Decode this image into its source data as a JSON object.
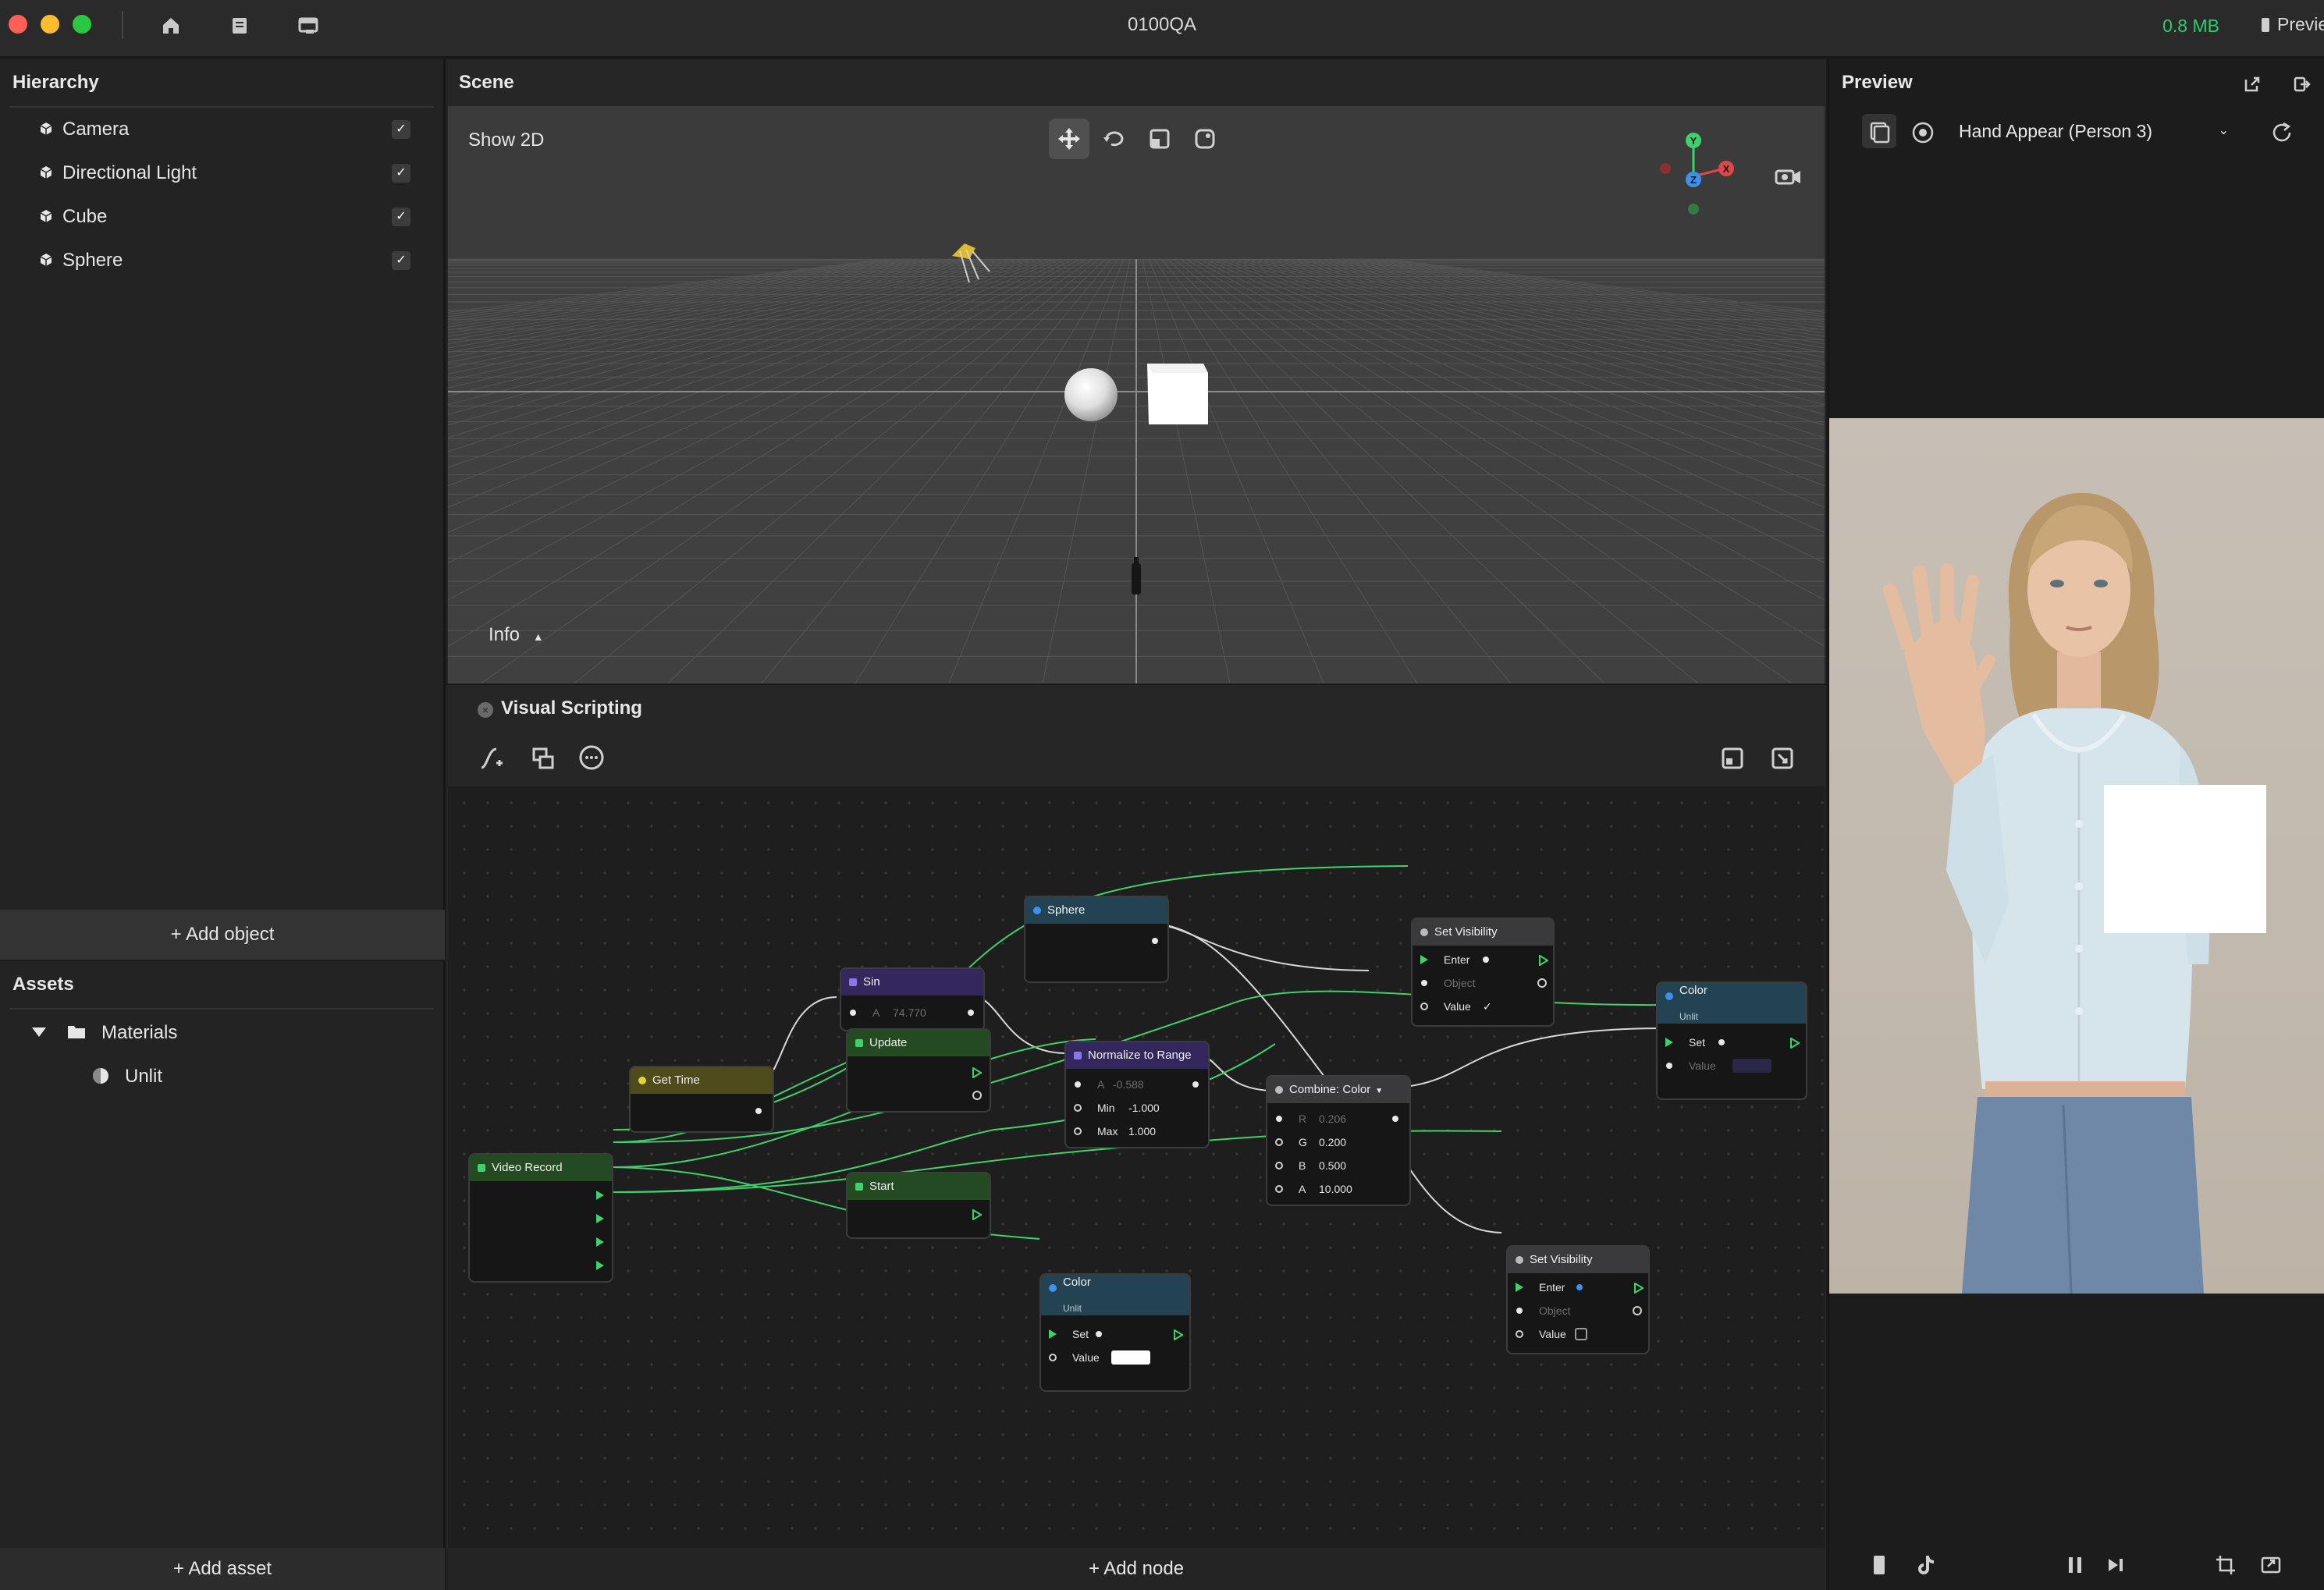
{
  "app": {
    "title": "0100QA",
    "memory": "0.8 MB",
    "preview_tab": "Preview"
  },
  "hierarchy": {
    "title": "Hierarchy",
    "items": [
      {
        "label": "Camera",
        "checked": true
      },
      {
        "label": "Directional Light",
        "checked": true
      },
      {
        "label": "Cube",
        "checked": true
      },
      {
        "label": "Sphere",
        "checked": true
      }
    ],
    "add_label": "+ Add object"
  },
  "assets": {
    "title": "Assets",
    "folder": "Materials",
    "items": [
      "Unlit"
    ],
    "add_label": "+ Add asset"
  },
  "scene": {
    "title": "Scene",
    "show2d": "Show 2D",
    "info": "Info",
    "axes": {
      "x": "X",
      "y": "Y",
      "z": "Z"
    },
    "axis_colors": {
      "x": "#e04848",
      "y": "#3fd16b",
      "z": "#3d8ff0"
    }
  },
  "visual_scripting": {
    "title": "Visual Scripting",
    "add_label": "+ Add node",
    "nodes": {
      "sphere": {
        "title": "Sphere"
      },
      "set_visibility_1": {
        "title": "Set Visibility",
        "enter": "Enter",
        "object": "Object",
        "value": "Value"
      },
      "sin": {
        "title": "Sin",
        "a_label": "A",
        "a_value": "74.770"
      },
      "update": {
        "title": "Update"
      },
      "normalize": {
        "title": "Normalize to Range",
        "a_label": "A",
        "a_value": "-0.588",
        "min_label": "Min",
        "min_value": "-1.000",
        "max_label": "Max",
        "max_value": "1.000"
      },
      "get_time": {
        "title": "Get Time"
      },
      "combine_color": {
        "title": "Combine: Color",
        "r_label": "R",
        "r_value": "0.206",
        "g_label": "G",
        "g_value": "0.200",
        "b_label": "B",
        "b_value": "0.500",
        "a_label": "A",
        "a_value": "10.000"
      },
      "color_top": {
        "title": "Color",
        "subtitle": "Unlit",
        "set": "Set",
        "value": "Value"
      },
      "video_record": {
        "title": "Video Record"
      },
      "start": {
        "title": "Start"
      },
      "set_visibility_2": {
        "title": "Set Visibility",
        "enter": "Enter",
        "object": "Object",
        "value": "Value"
      },
      "color_bottom": {
        "title": "Color",
        "subtitle": "Unlit",
        "set": "Set",
        "value": "Value"
      }
    },
    "colors": {
      "flow_wire": "#3fd16b",
      "data_wire": "#d8d8d8",
      "accent_blue": "#3d8ff0"
    }
  },
  "preview": {
    "title": "Preview",
    "effect": "Hand Appear (Person 3)"
  }
}
